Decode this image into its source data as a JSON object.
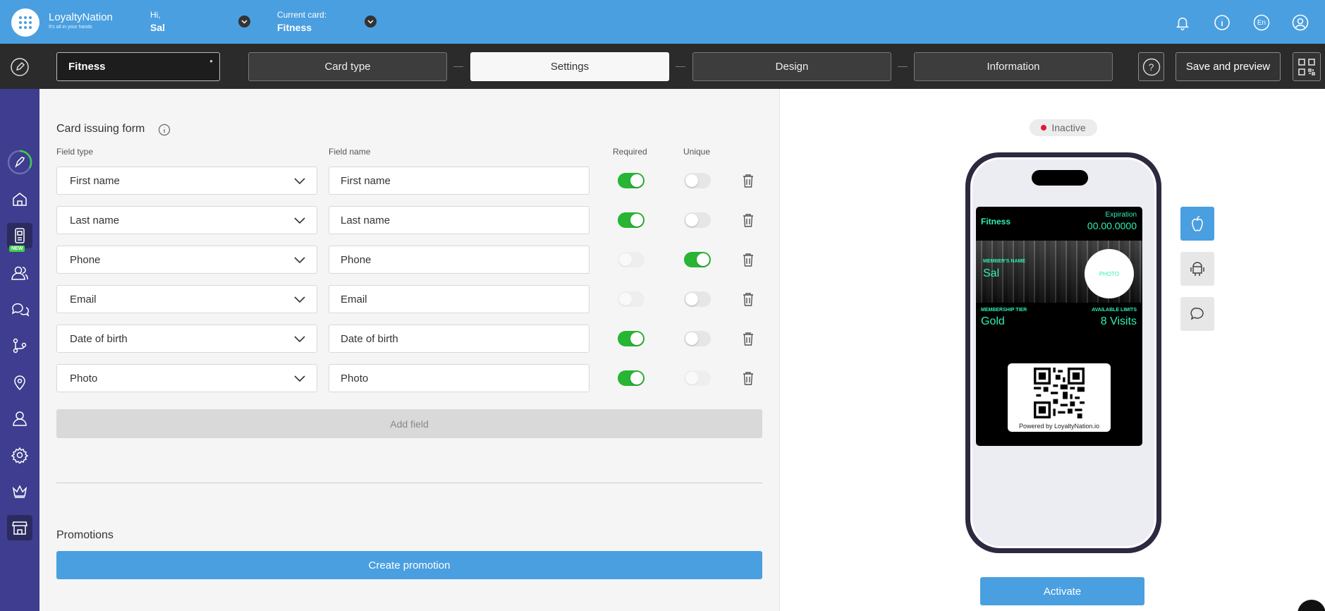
{
  "brand": {
    "name": "LoyaltyNation",
    "tagline": "It's all in your hands",
    "accent_color": "#4a9fe0"
  },
  "header": {
    "greeting": "Hi,",
    "user_name": "Sal",
    "current_card_label": "Current card:",
    "current_card_name": "Fitness",
    "language": "En",
    "icons": [
      "bell-icon",
      "info-icon",
      "language-icon",
      "account-icon"
    ]
  },
  "toolbar": {
    "card_name_value": "Fitness",
    "steps": [
      "Card type",
      "Settings",
      "Design",
      "Information"
    ],
    "active_step": "Settings",
    "help_label": "?",
    "save_label": "Save and preview"
  },
  "sidebar": {
    "new_badge": "NEW",
    "items": [
      "onboarding-progress",
      "home",
      "cards",
      "customers",
      "messages",
      "flows",
      "locations",
      "users",
      "settings",
      "plans",
      "store"
    ]
  },
  "form": {
    "title": "Card issuing form",
    "columns": {
      "field_type": "Field type",
      "field_name": "Field name",
      "required": "Required",
      "unique": "Unique"
    },
    "fields": [
      {
        "type": "First name",
        "name": "First name",
        "required": "on",
        "unique": "off"
      },
      {
        "type": "Last name",
        "name": "Last name",
        "required": "on",
        "unique": "off"
      },
      {
        "type": "Phone",
        "name": "Phone",
        "required": "disabled",
        "unique": "on"
      },
      {
        "type": "Email",
        "name": "Email",
        "required": "disabled",
        "unique": "off"
      },
      {
        "type": "Date of birth",
        "name": "Date of birth",
        "required": "on",
        "unique": "off"
      },
      {
        "type": "Photo",
        "name": "Photo",
        "required": "on",
        "unique": "disabled"
      }
    ],
    "add_field_label": "Add field"
  },
  "promotions": {
    "title": "Promotions",
    "create_label": "Create promotion"
  },
  "preview": {
    "status": "Inactive",
    "status_color": "#e3173e",
    "pass": {
      "title": "Fitness",
      "expiration_label": "Expiration",
      "expiration_value": "00.00.0000",
      "member_label": "MEMBER'S NAME",
      "member_value": "Sal",
      "photo_label": "PHOTO",
      "tier_label": "MEMBERSHIP TIER",
      "tier_value": "Gold",
      "limits_label": "AVAILABLE LIMITS",
      "limits_value": "8 Visits",
      "powered_by": "Powered by LoyaltyNation.io",
      "accent_color": "#2ff0b6"
    },
    "os_options": [
      "apple-icon",
      "android-icon",
      "chat-icon"
    ],
    "active_os": "apple-icon",
    "activate_label": "Activate"
  }
}
